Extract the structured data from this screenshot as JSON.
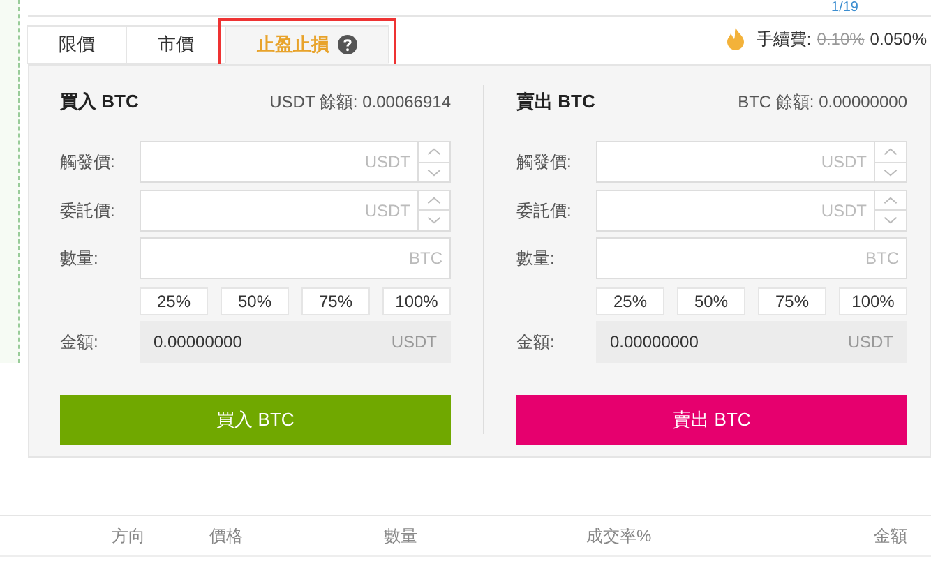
{
  "top_pager": "1/19",
  "tabs": [
    {
      "label": "限價",
      "selected": false,
      "help": false
    },
    {
      "label": "市價",
      "selected": false,
      "help": false
    },
    {
      "label": "止盈止損",
      "selected": true,
      "help": true
    }
  ],
  "fee": {
    "label": "手續費:",
    "old": "0.10%",
    "current": "0.050%"
  },
  "forms": [
    {
      "kind": "buy",
      "title": "買入 BTC",
      "balance": "USDT 餘額: 0.00066914",
      "fields": [
        {
          "label": "觸發價:",
          "unit": "USDT",
          "stepper": true
        },
        {
          "label": "委託價:",
          "unit": "USDT",
          "stepper": true
        },
        {
          "label": "數量:",
          "unit": "BTC",
          "stepper": false
        }
      ],
      "percents": [
        "25%",
        "50%",
        "75%",
        "100%"
      ],
      "amount": {
        "label": "金額:",
        "value": "0.00000000",
        "unit": "USDT"
      },
      "button": "買入 BTC"
    },
    {
      "kind": "sell",
      "title": "賣出 BTC",
      "balance": "BTC 餘額: 0.00000000",
      "fields": [
        {
          "label": "觸發價:",
          "unit": "USDT",
          "stepper": true
        },
        {
          "label": "委託價:",
          "unit": "USDT",
          "stepper": true
        },
        {
          "label": "數量:",
          "unit": "BTC",
          "stepper": false
        }
      ],
      "percents": [
        "25%",
        "50%",
        "75%",
        "100%"
      ],
      "amount": {
        "label": "金額:",
        "value": "0.00000000",
        "unit": "USDT"
      },
      "button": "賣出 BTC"
    }
  ],
  "table": {
    "columns": [
      "方向",
      "價格",
      "數量",
      "成交率%",
      "金額"
    ]
  }
}
